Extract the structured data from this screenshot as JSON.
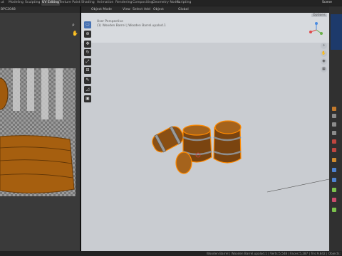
{
  "workspaces": [
    "ut",
    "Modeling",
    "Sculpting",
    "UV Editing",
    "Texture Paint",
    "Shading",
    "Animation",
    "Rendering",
    "Compositing",
    "Geometry Nodes",
    "Scripting"
  ],
  "active_workspace": "UV Editing",
  "scene_label": "Scene",
  "uv_editor": {
    "header_label": "BPC2048"
  },
  "viewport": {
    "mode": "Object Mode",
    "menus": [
      "View",
      "Select",
      "Add",
      "Object"
    ],
    "transform_orientation": "Global",
    "options_label": "Options",
    "view_name": "User Perspective",
    "collection_info": "(1) Wooden Barrel | Wooden Barrel.upalod.1"
  },
  "tools": [
    "select-box",
    "cursor",
    "move",
    "rotate",
    "scale",
    "transform",
    "annotate",
    "measure",
    "add-cube"
  ],
  "nav_gizmo": [
    "zoom",
    "hand",
    "camera",
    "grid"
  ],
  "status_bar": "Wooden Barrel | Wooden Barrel.upalod.1 | Verts:5,548 | Faces:5,287 | Tris:9,842 | Objects:"
}
